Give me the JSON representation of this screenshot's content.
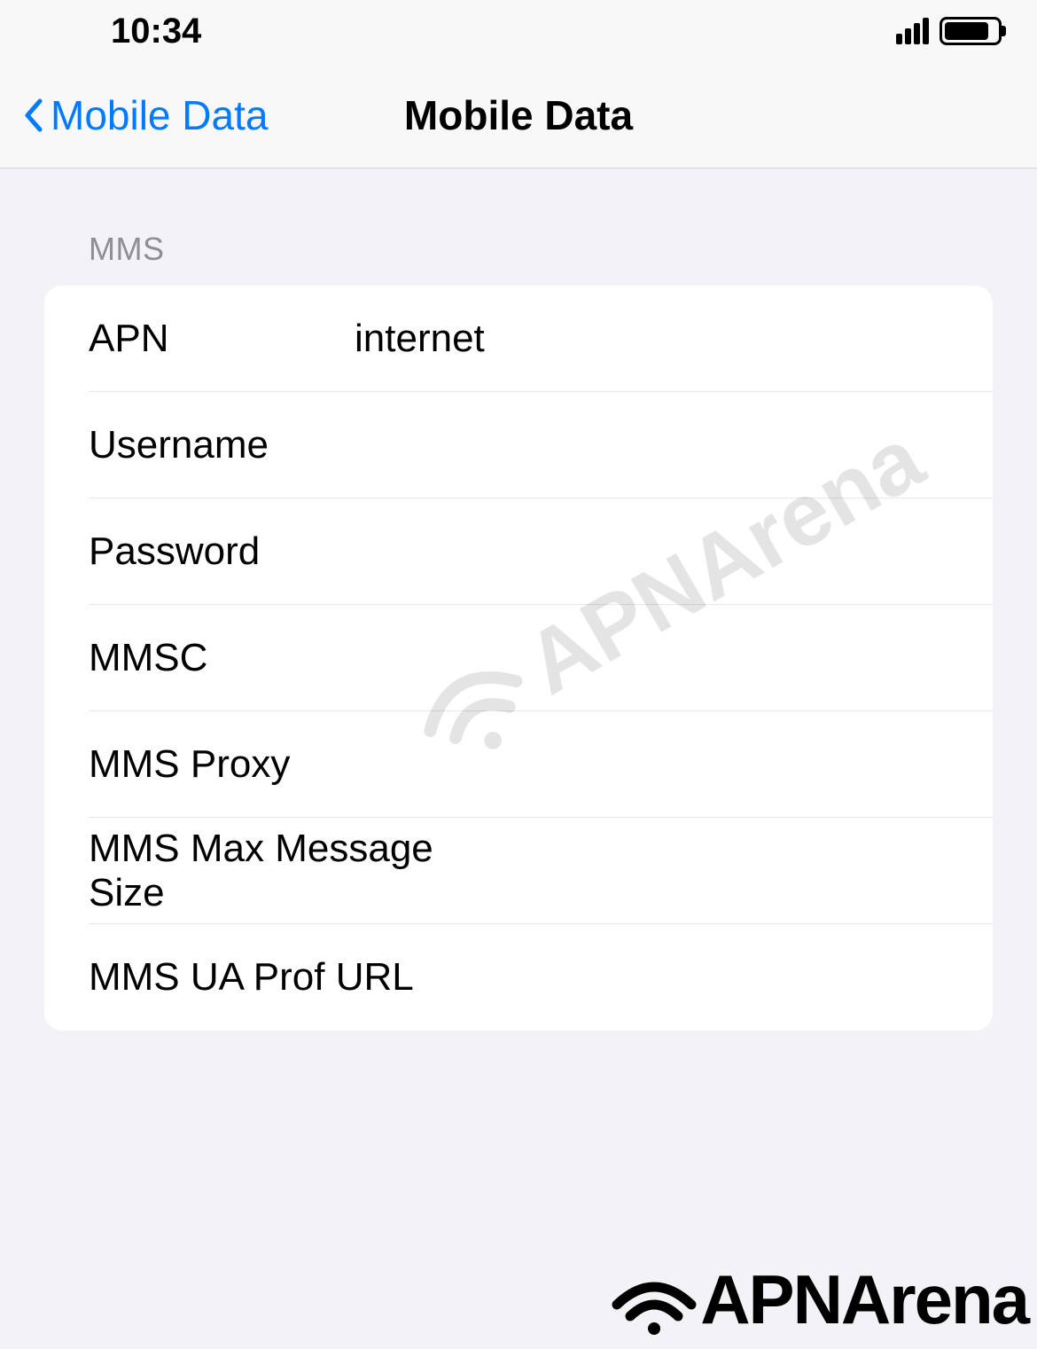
{
  "statusBar": {
    "time": "10:34"
  },
  "navBar": {
    "backLabel": "Mobile Data",
    "title": "Mobile Data"
  },
  "section": {
    "header": "MMS",
    "rows": [
      {
        "label": "APN",
        "value": "internet"
      },
      {
        "label": "Username",
        "value": ""
      },
      {
        "label": "Password",
        "value": ""
      },
      {
        "label": "MMSC",
        "value": ""
      },
      {
        "label": "MMS Proxy",
        "value": ""
      },
      {
        "label": "MMS Max Message Size",
        "value": ""
      },
      {
        "label": "MMS UA Prof URL",
        "value": ""
      }
    ]
  },
  "watermark": {
    "text": "APNArena"
  },
  "footer": {
    "logoText": "APNArena"
  }
}
